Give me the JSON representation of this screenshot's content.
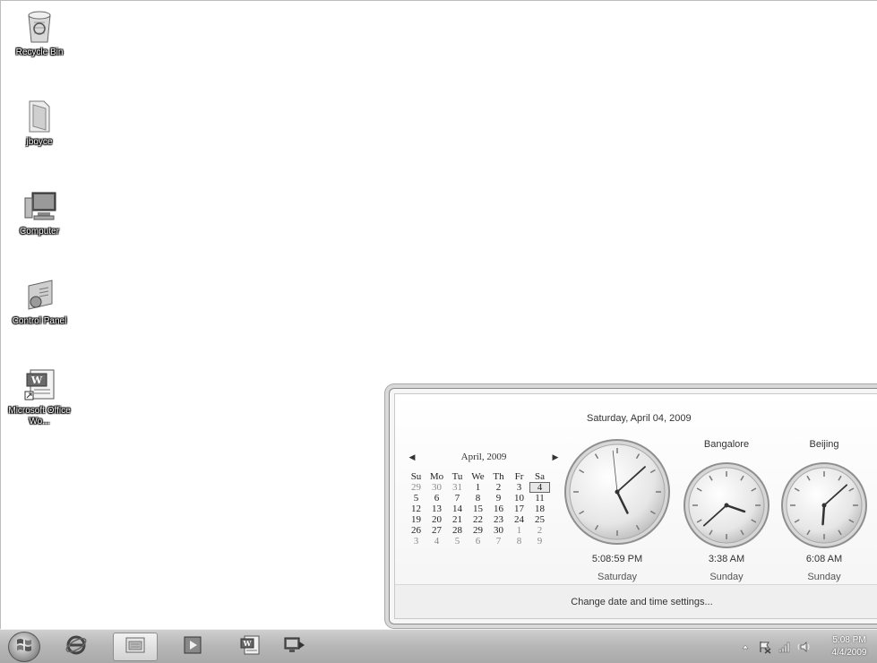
{
  "desktop": {
    "icons": [
      {
        "label": "Recycle Bin",
        "icon": "recycle-bin-icon"
      },
      {
        "label": "jboyce",
        "icon": "user-folder-icon"
      },
      {
        "label": "Computer",
        "icon": "computer-icon"
      },
      {
        "label": "Control Panel",
        "icon": "control-panel-icon"
      },
      {
        "label": "Microsoft Office Wo...",
        "icon": "word-shortcut-icon"
      }
    ]
  },
  "flyout": {
    "date_heading": "Saturday, April 04, 2009",
    "calendar": {
      "month_label": "April, 2009",
      "prev_icon": "prev-month-icon",
      "next_icon": "next-month-icon",
      "weekdays": [
        "Su",
        "Mo",
        "Tu",
        "We",
        "Th",
        "Fr",
        "Sa"
      ],
      "weeks": [
        [
          "29",
          "30",
          "31",
          "1",
          "2",
          "3",
          "4"
        ],
        [
          "5",
          "6",
          "7",
          "8",
          "9",
          "10",
          "11"
        ],
        [
          "12",
          "13",
          "14",
          "15",
          "16",
          "17",
          "18"
        ],
        [
          "19",
          "20",
          "21",
          "22",
          "23",
          "24",
          "25"
        ],
        [
          "26",
          "27",
          "28",
          "29",
          "30",
          "1",
          "2"
        ],
        [
          "3",
          "4",
          "5",
          "6",
          "7",
          "8",
          "9"
        ]
      ],
      "today": "4"
    },
    "clocks": [
      {
        "name": "",
        "time": "5:08:59 PM",
        "day": "Saturday",
        "hour": 17,
        "minute": 8,
        "second": 59
      },
      {
        "name": "Bangalore",
        "time": "3:38 AM",
        "day": "Sunday",
        "hour": 3,
        "minute": 38,
        "second": null
      },
      {
        "name": "Beijing",
        "time": "6:08 AM",
        "day": "Sunday",
        "hour": 6,
        "minute": 8,
        "second": null
      }
    ],
    "footer_link": "Change date and time settings..."
  },
  "taskbar": {
    "start_icon": "windows-start-icon",
    "pinned": [
      {
        "name": "internet-explorer",
        "icon": "internet-explorer-icon"
      },
      {
        "name": "windows-explorer",
        "icon": "folder-library-icon"
      },
      {
        "name": "media-player",
        "icon": "media-player-icon"
      },
      {
        "name": "word",
        "icon": "word-icon"
      },
      {
        "name": "remote-desktop",
        "icon": "remote-desktop-icon"
      }
    ],
    "tray": {
      "icons": [
        "show-hidden-icons-icon",
        "action-center-flag-icon",
        "network-signal-icon",
        "volume-speaker-icon"
      ],
      "time": "5:08 PM",
      "date": "4/4/2009"
    }
  }
}
